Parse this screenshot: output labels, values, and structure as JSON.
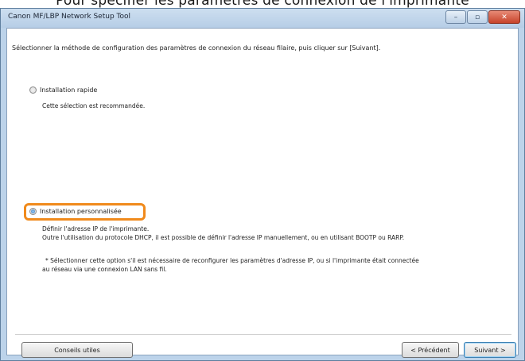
{
  "page_caption": "Pour spécifier les paramètres de connexion de l'imprimante",
  "window": {
    "title": "Canon MF/LBP Network Setup Tool",
    "controls": {
      "minimize": "–",
      "maximize": "▫",
      "close": "✕"
    }
  },
  "content": {
    "instruction": "Sélectionner la méthode de configuration des paramètres de connexion du réseau filaire, puis cliquer sur [Suivant].",
    "options": [
      {
        "label": "Installation rapide",
        "selected": false,
        "description": [
          "Cette sélection est recommandée."
        ]
      },
      {
        "label": "Installation personnalisée",
        "selected": true,
        "description": [
          "Définir l'adresse IP de l'imprimante.",
          "Outre l'utilisation du protocole DHCP, il est possible de définir l'adresse IP manuellement, ou en utilisant BOOTP ou RARP."
        ],
        "note": [
          "* Sélectionner cette option s'il est nécessaire de reconfigurer les paramètres d'adresse IP, ou si l'imprimante était connectée",
          "au réseau via une connexion LAN sans fil."
        ]
      }
    ]
  },
  "footer": {
    "tips_label": "Conseils utiles",
    "back_label": "< Précédent",
    "next_label": "Suivant >"
  },
  "colors": {
    "highlight": "#f08a1c",
    "window_frame": "#bcd3ea"
  }
}
